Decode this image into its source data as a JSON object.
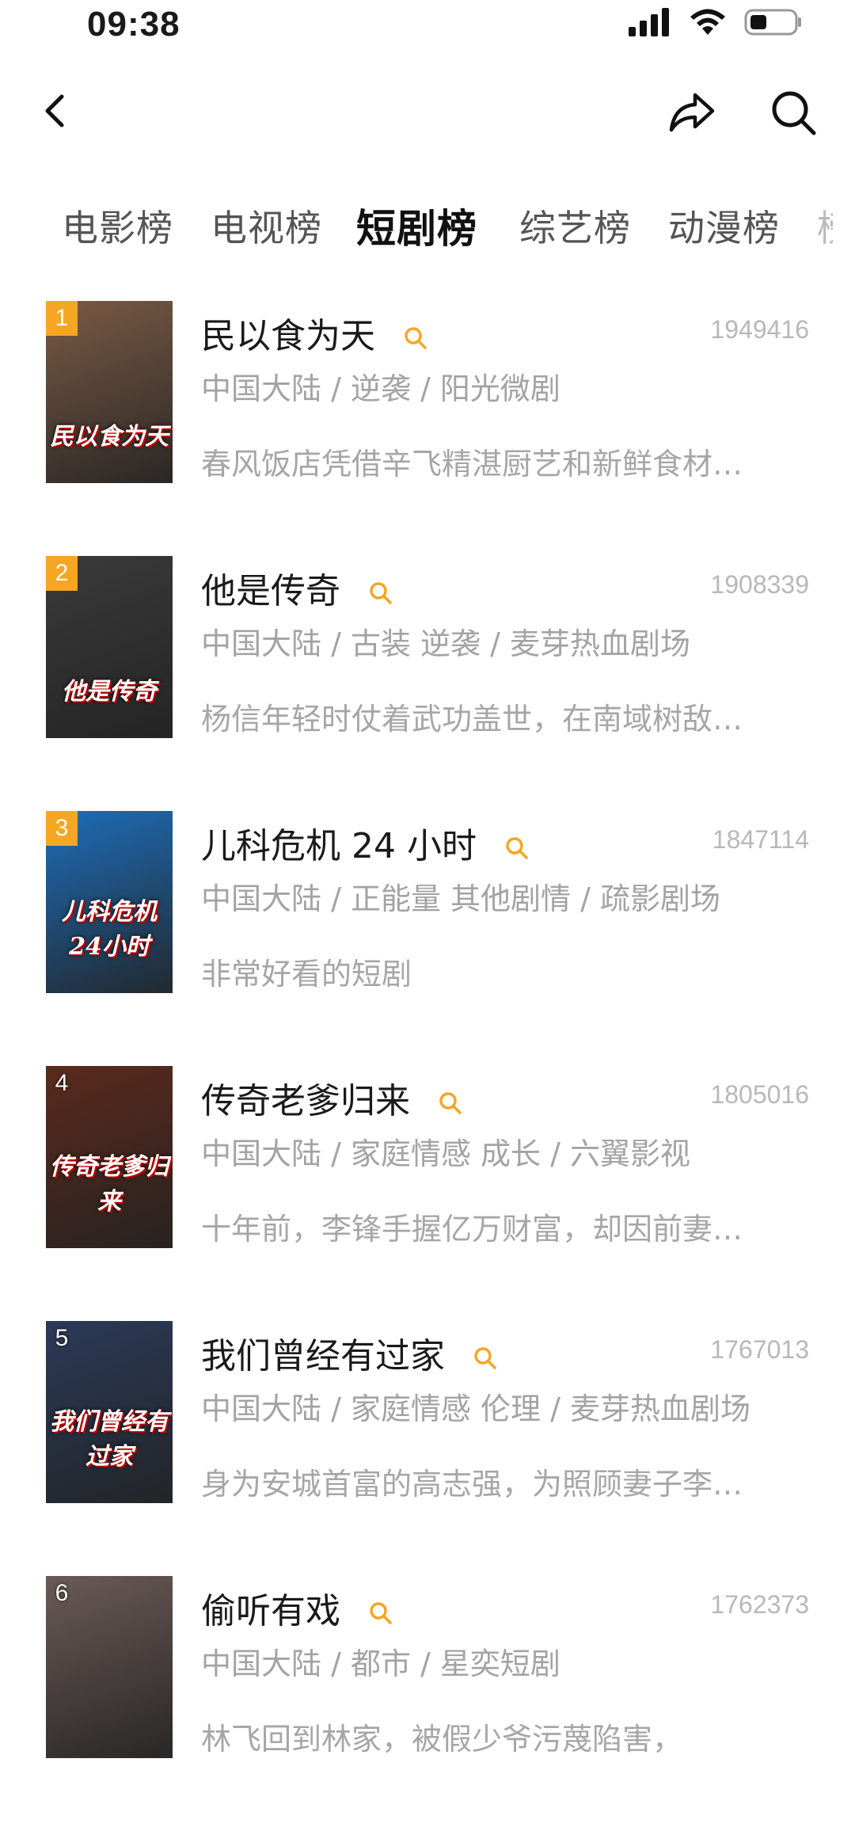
{
  "status": {
    "time": "09:38"
  },
  "tabs": [
    {
      "label": "电影榜",
      "active": false
    },
    {
      "label": "电视榜",
      "active": false
    },
    {
      "label": "短剧榜",
      "active": true
    },
    {
      "label": "综艺榜",
      "active": false
    },
    {
      "label": "动漫榜",
      "active": false
    }
  ],
  "items": [
    {
      "rank": "1",
      "title": "民以食为天",
      "score": "1949416",
      "meta": "中国大陆 / 逆袭 / 阳光微剧",
      "desc": "春风饭店凭借辛飞精湛厨艺和新鲜食材…",
      "poster_text": "民以食为天",
      "poster_bg": "#7a5a44",
      "rank_style": "gold"
    },
    {
      "rank": "2",
      "title": "他是传奇",
      "score": "1908339",
      "meta": "中国大陆 / 古装 逆袭 / 麦芽热血剧场",
      "desc": "杨信年轻时仗着武功盖世，在南域树敌…",
      "poster_text": "他是传奇",
      "poster_bg": "#3a3a3a",
      "rank_style": "gold"
    },
    {
      "rank": "3",
      "title": "儿科危机 24 小时",
      "score": "1847114",
      "meta": "中国大陆 / 正能量 其他剧情 / 疏影剧场",
      "desc": "非常好看的短剧",
      "poster_text": "儿科危机 24小时",
      "poster_bg": "#1e6db8",
      "rank_style": "gold"
    },
    {
      "rank": "4",
      "title": "传奇老爹归来",
      "score": "1805016",
      "meta": "中国大陆 / 家庭情感 成长 / 六翼影视",
      "desc": "十年前，李锋手握亿万财富，却因前妻…",
      "poster_text": "传奇老爹归来",
      "poster_bg": "#5a2a1c",
      "rank_style": "plain"
    },
    {
      "rank": "5",
      "title": "我们曾经有过家",
      "score": "1767013",
      "meta": "中国大陆 / 家庭情感 伦理 / 麦芽热血剧场",
      "desc": "身为安城首富的高志强，为照顾妻子李…",
      "poster_text": "我们曾经有过家",
      "poster_bg": "#2b3a58",
      "rank_style": "plain"
    },
    {
      "rank": "6",
      "title": "偷听有戏",
      "score": "1762373",
      "meta": "中国大陆 / 都市 / 星奕短剧",
      "desc": "林飞回到林家，被假少爷污蔑陷害，",
      "poster_text": "",
      "poster_bg": "#6a5a56",
      "rank_style": "plain"
    }
  ],
  "colors": {
    "accent": "#f5a623",
    "muted": "#a6a6a6"
  }
}
